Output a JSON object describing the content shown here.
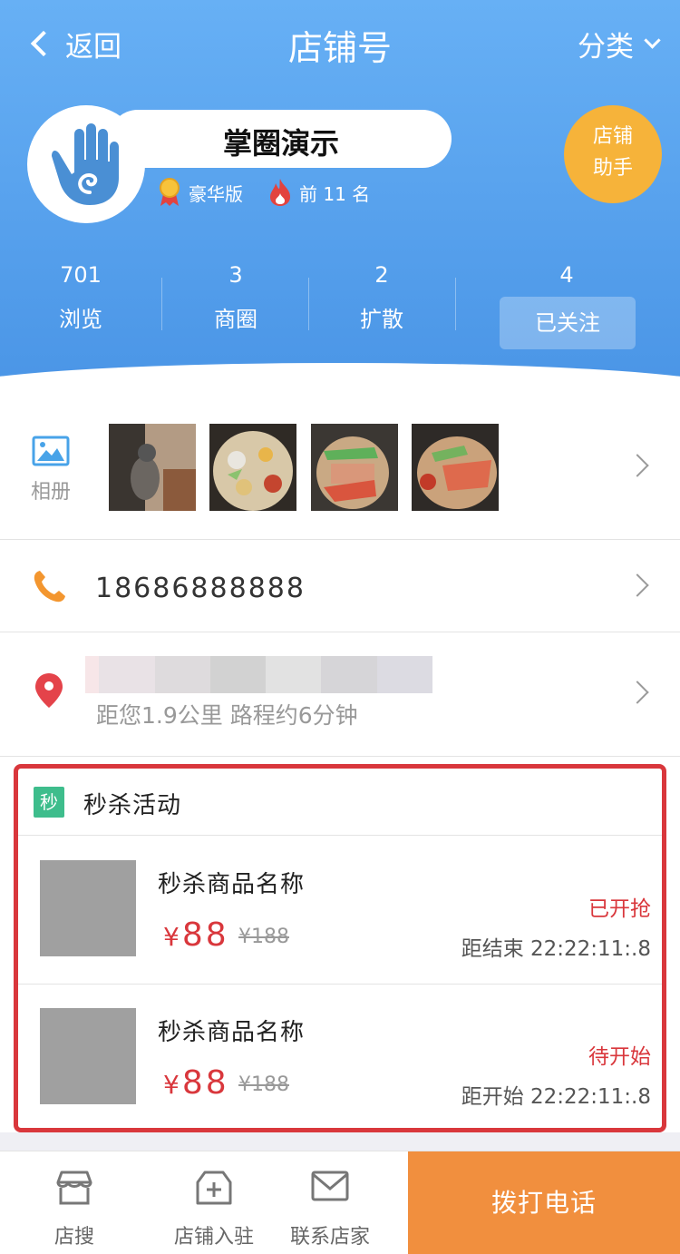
{
  "nav": {
    "back_label": "返回",
    "title": "店铺号",
    "category_label": "分类"
  },
  "store": {
    "name": "掌圈演示",
    "tier": "豪华版",
    "rank": "前 11 名",
    "assistant_label": "店铺\n助手"
  },
  "stats": [
    {
      "value": "701",
      "label": "浏览"
    },
    {
      "value": "3",
      "label": "商圈"
    },
    {
      "value": "2",
      "label": "扩散"
    }
  ],
  "follow": {
    "count": "4",
    "label": "已关注"
  },
  "album": {
    "label": "相册"
  },
  "contact": {
    "phone": "18686888888"
  },
  "address": {
    "distance_text": "距您1.9公里 路程约6分钟"
  },
  "flash_sale": {
    "badge": "秒",
    "title": "秒杀活动",
    "items": [
      {
        "name": "秒杀商品名称",
        "currency": "¥",
        "price": "88",
        "original": "¥188",
        "status": "已开抢",
        "timer": "距结束 22:22:11:.8"
      },
      {
        "name": "秒杀商品名称",
        "currency": "¥",
        "price": "88",
        "original": "¥188",
        "status": "待开始",
        "timer": "距开始 22:22:11:.8"
      }
    ]
  },
  "bottom_bar": {
    "tabs": [
      {
        "label": "店搜",
        "icon": "store-icon"
      },
      {
        "label": "店铺入驻",
        "icon": "shop-plus-icon"
      },
      {
        "label": "联系店家",
        "icon": "mail-icon"
      }
    ],
    "call_label": "拨打电话"
  },
  "colors": {
    "header": "#5aa2ee",
    "accent_red": "#d9373c",
    "call_button": "#f18f3e",
    "assistant": "#f6b33a"
  }
}
